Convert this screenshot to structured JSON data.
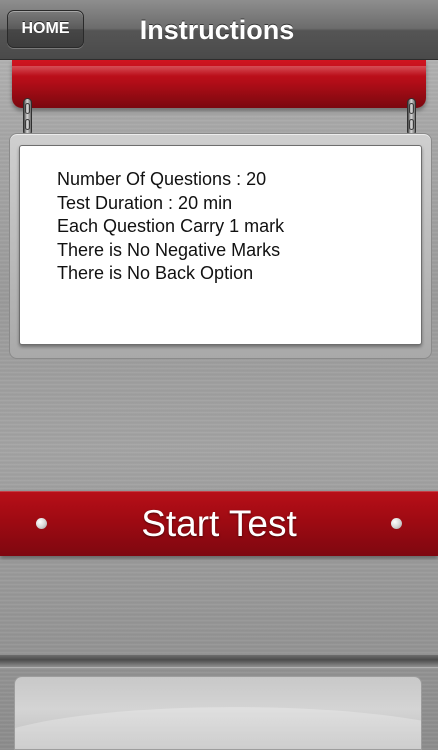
{
  "nav": {
    "home_label": "HOME",
    "title": "Instructions"
  },
  "instructions": {
    "lines": [
      "Number Of Questions : 20",
      "Test Duration : 20 min",
      "Each Question Carry 1 mark",
      "There is No Negative Marks",
      "There is No Back Option"
    ]
  },
  "actions": {
    "start_label": "Start Test"
  },
  "colors": {
    "banner_red": "#b30d18",
    "nav_gray": "#5a5a5a",
    "card_white": "#ffffff"
  }
}
